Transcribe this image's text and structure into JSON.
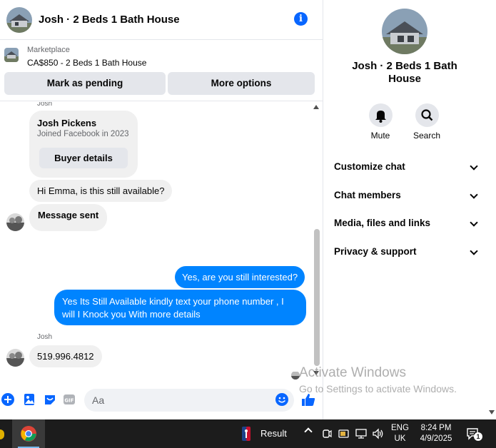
{
  "header": {
    "title": "Josh · 2 Beds 1 Bath House"
  },
  "marketplace": {
    "label": "Marketplace",
    "listing": "CA$850 - 2 Beds 1 Bath House",
    "mark_pending": "Mark as pending",
    "more_options": "More options"
  },
  "messages": {
    "top_sender": "Josh",
    "card": {
      "name": "Josh Pickens",
      "joined": "Joined Facebook in 2023",
      "buyer_details": "Buyer details"
    },
    "in1": "Hi Emma, is this still available?",
    "in2": "Message sent",
    "out1": "Yes, are you still interested?",
    "out2_line1": "Yes Its Still Available kindly text your phone number , I",
    "out2_line2": "will I Knock you With more details",
    "sender2": "Josh",
    "in3": "519.996.4812"
  },
  "composer": {
    "placeholder": "Aa"
  },
  "side": {
    "title": "Josh · 2 Beds 1 Bath House",
    "mute": "Mute",
    "search": "Search",
    "menu": [
      "Customize chat",
      "Chat members",
      "Media, files and links",
      "Privacy & support"
    ]
  },
  "watermark": {
    "title": "Activate Windows",
    "subtitle": "Go to Settings to activate Windows."
  },
  "taskbar": {
    "result": "Result",
    "lang1": "ENG",
    "lang2": "UK",
    "time": "8:24 PM",
    "date": "4/9/2025",
    "notifications": "1"
  },
  "colors": {
    "accent": "#0084ff",
    "info": "#0866ff",
    "like": "#0866ff"
  }
}
